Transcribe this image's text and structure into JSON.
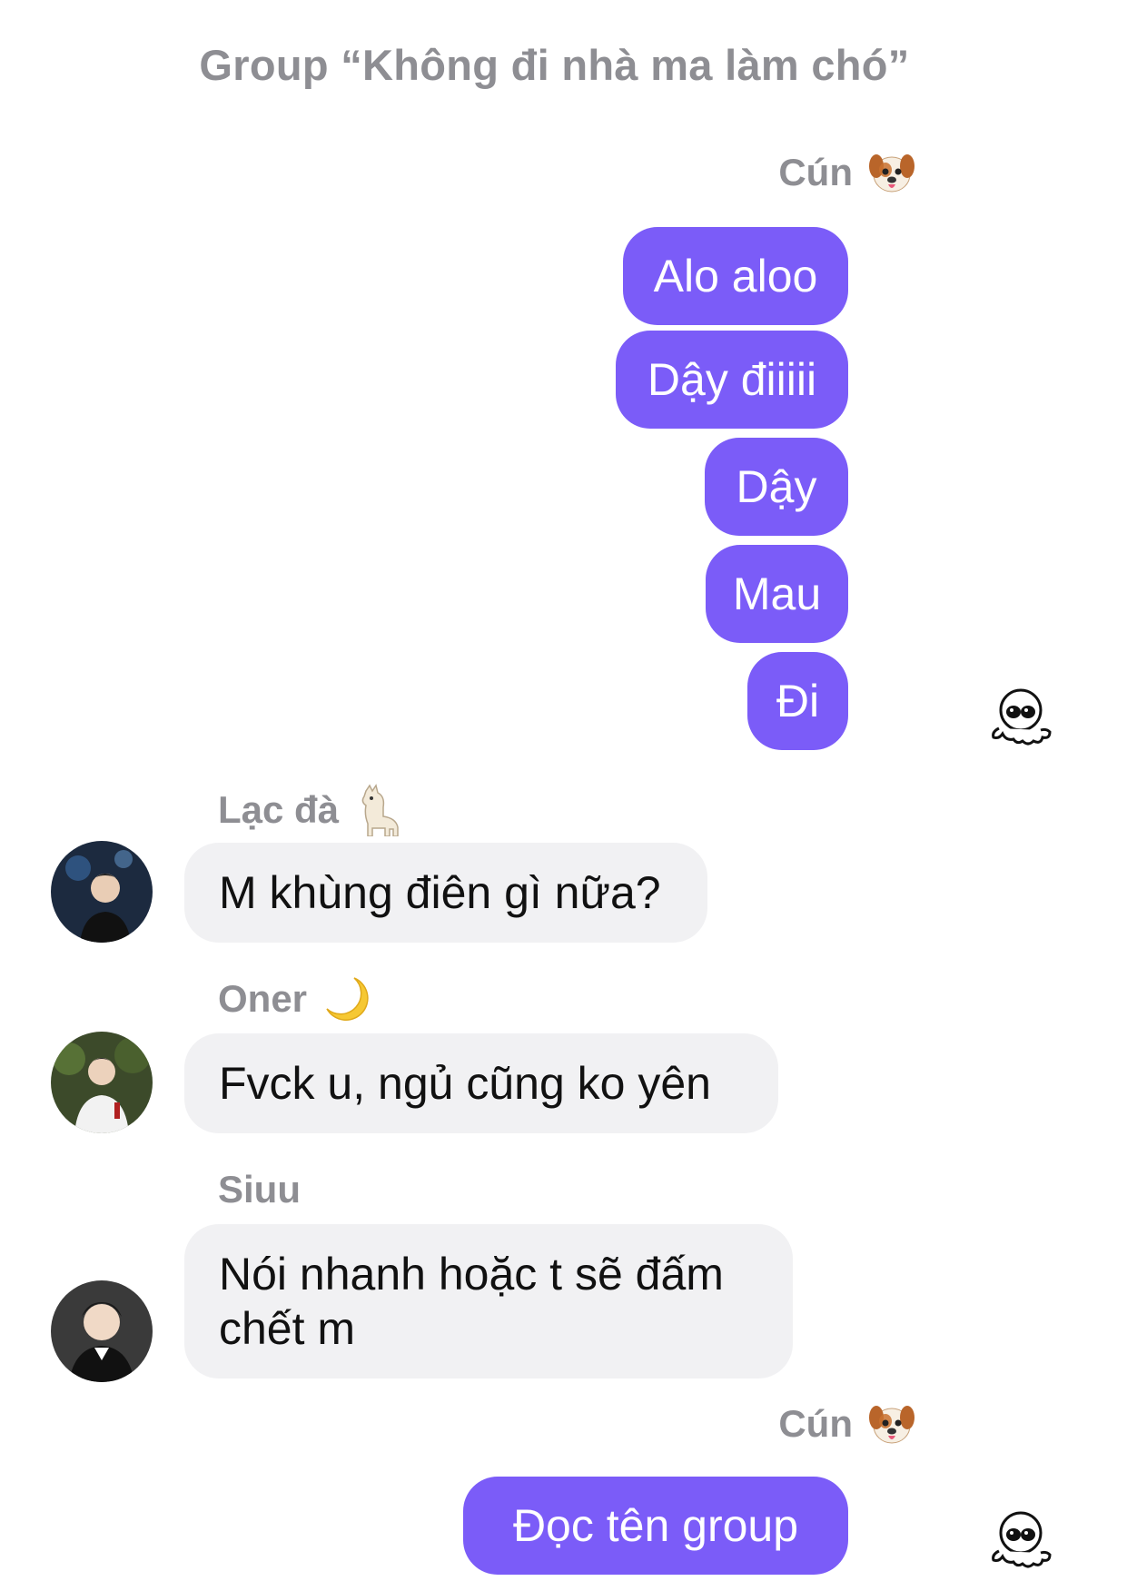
{
  "header": {
    "title": "Group “Không đi nhà ma làm chó”"
  },
  "messages": {
    "group1": {
      "sender": "Cún",
      "sender_emoji": "dog-face",
      "bubbles": [
        "Alo aloo",
        "Dậy điiiii",
        "Dậy",
        "Mau",
        "Đi"
      ]
    },
    "group2": {
      "sender": "Lạc đà",
      "sender_emoji": "llama",
      "text": "M khùng điên gì nữa?"
    },
    "group3": {
      "sender": "Oner",
      "sender_emoji": "crescent-moon",
      "text": "Fvck u, ngủ cũng ko yên"
    },
    "group4": {
      "sender": "Siuu",
      "text_line1": "Nói nhanh hoặc t sẽ đấm",
      "text_line2": "chết m"
    },
    "group5": {
      "sender": "Cún",
      "sender_emoji": "dog-face",
      "text": "Đọc tên group"
    }
  },
  "colors": {
    "outgoing_bubble": "#7b5cf8",
    "incoming_bubble": "#f1f1f3",
    "sender_name": "#8e8e93"
  }
}
